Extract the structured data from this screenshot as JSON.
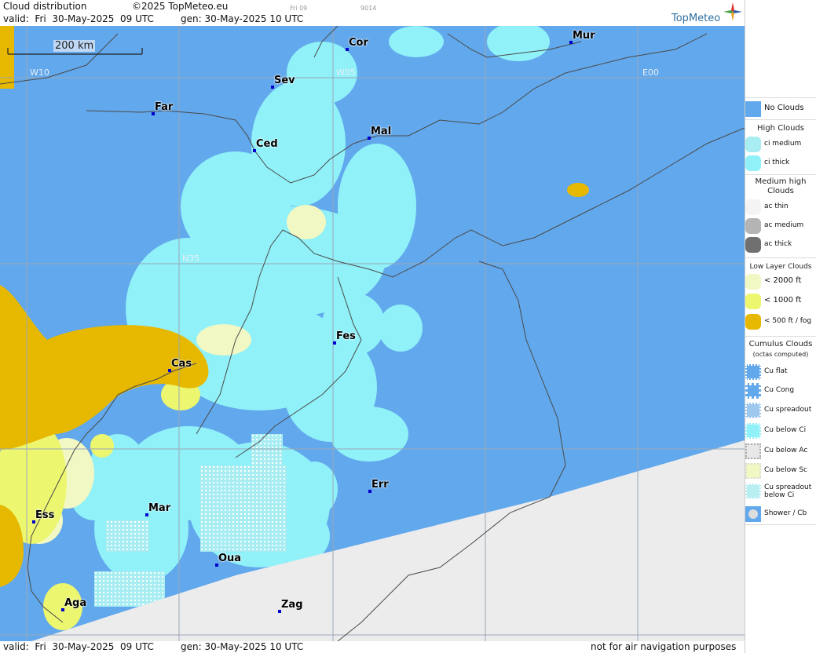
{
  "header": {
    "title": "Cloud distribution",
    "copyright": "©2025 TopMeteo.eu",
    "small_day": "Fri 09",
    "small_code": "9014",
    "valid": "valid:  Fri  30-May-2025  09 UTC",
    "gen": "gen: 30-May-2025 10 UTC",
    "brand": "TopMeteo"
  },
  "footer": {
    "valid": "valid:  Fri  30-May-2025  09 UTC",
    "gen": "gen: 30-May-2025 10 UTC",
    "disclaimer": "not for air navigation purposes"
  },
  "map": {
    "scale_label": "200 km",
    "grid_labels": [
      "W10",
      "W05",
      "E00",
      "N35"
    ],
    "cities": [
      "Cor",
      "Mur",
      "Sev",
      "Far",
      "Mal",
      "Ced",
      "Fes",
      "Cas",
      "Err",
      "Mar",
      "Ess",
      "Oua",
      "Aga",
      "Zag"
    ],
    "colors": {
      "no_clouds": "#62a8ec",
      "ci_thick": "#90f1f8",
      "ci_medium": "#a8edf2",
      "low_2000": "#f2f8c4",
      "low_1000": "#ecf66f",
      "fog": "#e6b800",
      "no_data": "#ececec",
      "coast": "#555555"
    }
  },
  "legend": {
    "no_clouds": "No Clouds",
    "high_title": "High Clouds",
    "ci_medium": "ci medium",
    "ci_thick": "ci thick",
    "medium_title": "Medium high Clouds",
    "ac_thin": "ac thin",
    "ac_medium": "ac medium",
    "ac_thick": "ac thick",
    "low_title": "Low Layer Clouds",
    "low_2000": "< 2000 ft",
    "low_1000": "< 1000 ft",
    "low_500": "< 500 ft / fog",
    "cumulus_title": "Cumulus Clouds",
    "cumulus_sub": "(octas computed)",
    "cu_flat": "Cu flat",
    "cu_cong": "Cu Cong",
    "cu_spreadout": "Cu spreadout",
    "cu_below_ci": "Cu below Ci",
    "cu_below_ac": "Cu below Ac",
    "cu_below_sc": "Cu below Sc",
    "cu_spreadout_ci": "Cu spreadout\nbelow Ci",
    "shower_cb": "Shower / Cb"
  }
}
